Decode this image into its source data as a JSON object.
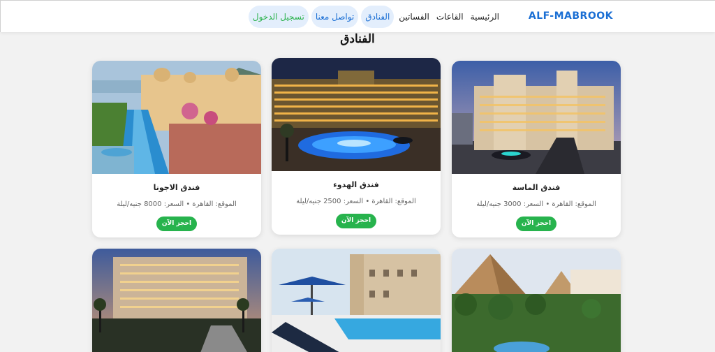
{
  "navbar": {
    "brand": "ALF-MABROOK",
    "links": {
      "home": "الرئيسية",
      "halls": "القاعات",
      "dresses": "الفساتين",
      "hotels": "الفنادق",
      "contact": "تواصل معنا",
      "login": "تسجيل الدخول"
    }
  },
  "page": {
    "title": "الفنادق"
  },
  "hotels": [
    {
      "name": "فندق الماسة",
      "meta": "الموقع: القاهرة • السعر: 3000 جنيه/ليلة",
      "book": "احجز الآن"
    },
    {
      "name": "فندق الهدوء",
      "meta": "الموقع: القاهرة • السعر: 2500 جنيه/ليلة",
      "book": "احجز الآن"
    },
    {
      "name": "فندق الاجونا",
      "meta": "الموقع: القاهرة • السعر: 8000 جنيه/ليلة",
      "book": "احجز الآن"
    }
  ],
  "colors": {
    "brand": "#1b6fd4",
    "book_button": "#27b34d",
    "login_text": "#2bb24c",
    "pill_bg": "#e3eefc"
  }
}
